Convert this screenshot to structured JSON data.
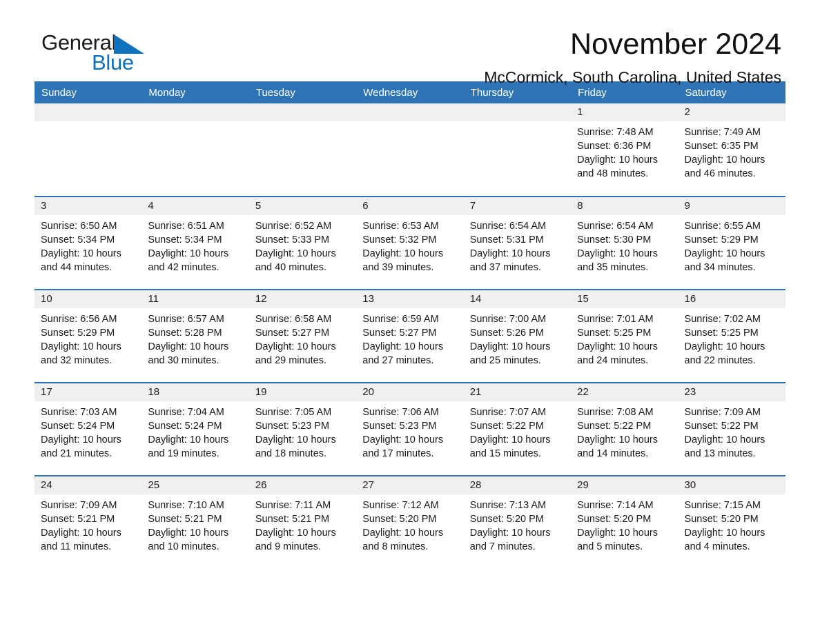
{
  "brand": {
    "name_part1": "General",
    "name_part2": "Blue",
    "accent_color": "#1071bd"
  },
  "header": {
    "title": "November 2024",
    "location": "McCormick, South Carolina, United States"
  },
  "calendar": {
    "header_color": "#2e74b5",
    "weekday_headers": [
      "Sunday",
      "Monday",
      "Tuesday",
      "Wednesday",
      "Thursday",
      "Friday",
      "Saturday"
    ],
    "weeks": [
      [
        {
          "day": "",
          "sunrise": "",
          "sunset": "",
          "daylight": ""
        },
        {
          "day": "",
          "sunrise": "",
          "sunset": "",
          "daylight": ""
        },
        {
          "day": "",
          "sunrise": "",
          "sunset": "",
          "daylight": ""
        },
        {
          "day": "",
          "sunrise": "",
          "sunset": "",
          "daylight": ""
        },
        {
          "day": "",
          "sunrise": "",
          "sunset": "",
          "daylight": ""
        },
        {
          "day": "1",
          "sunrise": "Sunrise: 7:48 AM",
          "sunset": "Sunset: 6:36 PM",
          "daylight": "Daylight: 10 hours and 48 minutes."
        },
        {
          "day": "2",
          "sunrise": "Sunrise: 7:49 AM",
          "sunset": "Sunset: 6:35 PM",
          "daylight": "Daylight: 10 hours and 46 minutes."
        }
      ],
      [
        {
          "day": "3",
          "sunrise": "Sunrise: 6:50 AM",
          "sunset": "Sunset: 5:34 PM",
          "daylight": "Daylight: 10 hours and 44 minutes."
        },
        {
          "day": "4",
          "sunrise": "Sunrise: 6:51 AM",
          "sunset": "Sunset: 5:34 PM",
          "daylight": "Daylight: 10 hours and 42 minutes."
        },
        {
          "day": "5",
          "sunrise": "Sunrise: 6:52 AM",
          "sunset": "Sunset: 5:33 PM",
          "daylight": "Daylight: 10 hours and 40 minutes."
        },
        {
          "day": "6",
          "sunrise": "Sunrise: 6:53 AM",
          "sunset": "Sunset: 5:32 PM",
          "daylight": "Daylight: 10 hours and 39 minutes."
        },
        {
          "day": "7",
          "sunrise": "Sunrise: 6:54 AM",
          "sunset": "Sunset: 5:31 PM",
          "daylight": "Daylight: 10 hours and 37 minutes."
        },
        {
          "day": "8",
          "sunrise": "Sunrise: 6:54 AM",
          "sunset": "Sunset: 5:30 PM",
          "daylight": "Daylight: 10 hours and 35 minutes."
        },
        {
          "day": "9",
          "sunrise": "Sunrise: 6:55 AM",
          "sunset": "Sunset: 5:29 PM",
          "daylight": "Daylight: 10 hours and 34 minutes."
        }
      ],
      [
        {
          "day": "10",
          "sunrise": "Sunrise: 6:56 AM",
          "sunset": "Sunset: 5:29 PM",
          "daylight": "Daylight: 10 hours and 32 minutes."
        },
        {
          "day": "11",
          "sunrise": "Sunrise: 6:57 AM",
          "sunset": "Sunset: 5:28 PM",
          "daylight": "Daylight: 10 hours and 30 minutes."
        },
        {
          "day": "12",
          "sunrise": "Sunrise: 6:58 AM",
          "sunset": "Sunset: 5:27 PM",
          "daylight": "Daylight: 10 hours and 29 minutes."
        },
        {
          "day": "13",
          "sunrise": "Sunrise: 6:59 AM",
          "sunset": "Sunset: 5:27 PM",
          "daylight": "Daylight: 10 hours and 27 minutes."
        },
        {
          "day": "14",
          "sunrise": "Sunrise: 7:00 AM",
          "sunset": "Sunset: 5:26 PM",
          "daylight": "Daylight: 10 hours and 25 minutes."
        },
        {
          "day": "15",
          "sunrise": "Sunrise: 7:01 AM",
          "sunset": "Sunset: 5:25 PM",
          "daylight": "Daylight: 10 hours and 24 minutes."
        },
        {
          "day": "16",
          "sunrise": "Sunrise: 7:02 AM",
          "sunset": "Sunset: 5:25 PM",
          "daylight": "Daylight: 10 hours and 22 minutes."
        }
      ],
      [
        {
          "day": "17",
          "sunrise": "Sunrise: 7:03 AM",
          "sunset": "Sunset: 5:24 PM",
          "daylight": "Daylight: 10 hours and 21 minutes."
        },
        {
          "day": "18",
          "sunrise": "Sunrise: 7:04 AM",
          "sunset": "Sunset: 5:24 PM",
          "daylight": "Daylight: 10 hours and 19 minutes."
        },
        {
          "day": "19",
          "sunrise": "Sunrise: 7:05 AM",
          "sunset": "Sunset: 5:23 PM",
          "daylight": "Daylight: 10 hours and 18 minutes."
        },
        {
          "day": "20",
          "sunrise": "Sunrise: 7:06 AM",
          "sunset": "Sunset: 5:23 PM",
          "daylight": "Daylight: 10 hours and 17 minutes."
        },
        {
          "day": "21",
          "sunrise": "Sunrise: 7:07 AM",
          "sunset": "Sunset: 5:22 PM",
          "daylight": "Daylight: 10 hours and 15 minutes."
        },
        {
          "day": "22",
          "sunrise": "Sunrise: 7:08 AM",
          "sunset": "Sunset: 5:22 PM",
          "daylight": "Daylight: 10 hours and 14 minutes."
        },
        {
          "day": "23",
          "sunrise": "Sunrise: 7:09 AM",
          "sunset": "Sunset: 5:22 PM",
          "daylight": "Daylight: 10 hours and 13 minutes."
        }
      ],
      [
        {
          "day": "24",
          "sunrise": "Sunrise: 7:09 AM",
          "sunset": "Sunset: 5:21 PM",
          "daylight": "Daylight: 10 hours and 11 minutes."
        },
        {
          "day": "25",
          "sunrise": "Sunrise: 7:10 AM",
          "sunset": "Sunset: 5:21 PM",
          "daylight": "Daylight: 10 hours and 10 minutes."
        },
        {
          "day": "26",
          "sunrise": "Sunrise: 7:11 AM",
          "sunset": "Sunset: 5:21 PM",
          "daylight": "Daylight: 10 hours and 9 minutes."
        },
        {
          "day": "27",
          "sunrise": "Sunrise: 7:12 AM",
          "sunset": "Sunset: 5:20 PM",
          "daylight": "Daylight: 10 hours and 8 minutes."
        },
        {
          "day": "28",
          "sunrise": "Sunrise: 7:13 AM",
          "sunset": "Sunset: 5:20 PM",
          "daylight": "Daylight: 10 hours and 7 minutes."
        },
        {
          "day": "29",
          "sunrise": "Sunrise: 7:14 AM",
          "sunset": "Sunset: 5:20 PM",
          "daylight": "Daylight: 10 hours and 5 minutes."
        },
        {
          "day": "30",
          "sunrise": "Sunrise: 7:15 AM",
          "sunset": "Sunset: 5:20 PM",
          "daylight": "Daylight: 10 hours and 4 minutes."
        }
      ]
    ]
  }
}
